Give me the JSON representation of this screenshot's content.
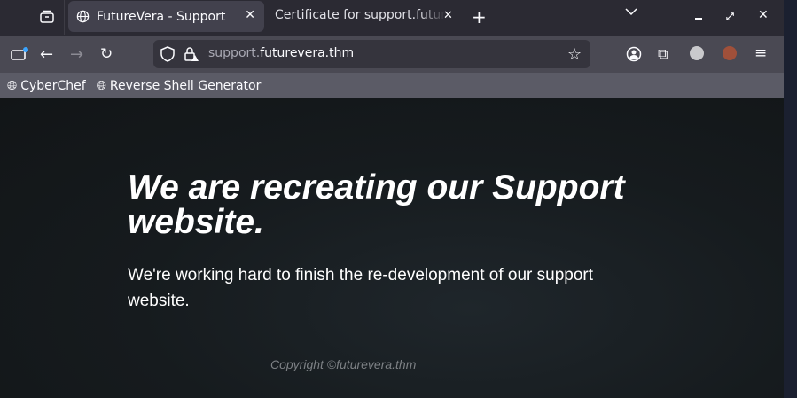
{
  "tabs": [
    {
      "title": "FutureVera - Support",
      "active": true
    },
    {
      "title": "Certificate for support.futurevera.thm",
      "active": false
    }
  ],
  "url": {
    "prefix": "support.",
    "domain": "futurevera.thm"
  },
  "bookmarks": [
    {
      "label": "CyberChef"
    },
    {
      "label": "Reverse Shell Generator"
    }
  ],
  "page": {
    "heading": "We are recreating our Support website.",
    "subtext": "We're working hard to finish the re-development of our support website.",
    "copyright": "Copyright ©futurevera.thm"
  }
}
